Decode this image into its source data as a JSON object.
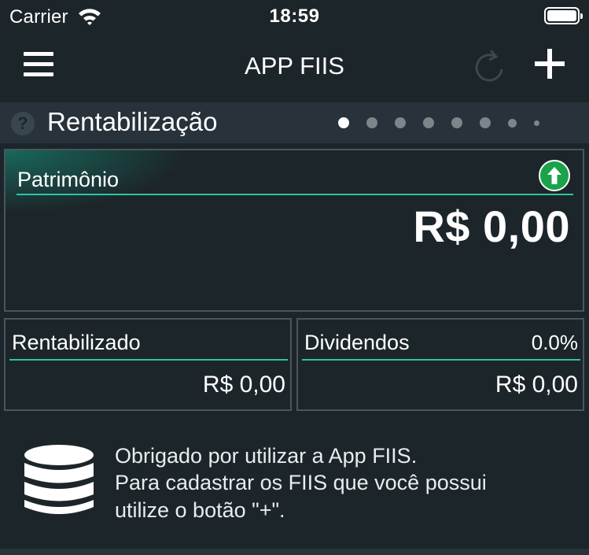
{
  "status_bar": {
    "carrier": "Carrier",
    "time": "18:59"
  },
  "nav": {
    "title": "APP FIIS",
    "icons": [
      "menu-icon",
      "refresh-icon",
      "add-icon"
    ]
  },
  "section": {
    "title": "Rentabilização",
    "help_icon_text": "?",
    "pages_total": 8,
    "active_page": 1
  },
  "cards": {
    "patrimonio": {
      "label": "Patrimônio",
      "value": "R$ 0,00",
      "trend_icon": "arrow-up-icon"
    },
    "rentabilizado": {
      "label": "Rentabilizado",
      "value": "R$ 0,00"
    },
    "dividendos": {
      "label": "Dividendos",
      "percent": "0.0%",
      "value": "R$ 0,00"
    }
  },
  "message": {
    "icon": "database-icon",
    "line1": "Obrigado por utilizar a App FIIS.",
    "line2": "Para cadastrar os FIIS que você possui",
    "line3": "utilize o botão \"+\"."
  },
  "colors": {
    "background": "#1c252a",
    "header_band": "#27323a",
    "accent": "#2fc4a4",
    "up_green": "#1aa34a",
    "card_border": "#4a555c"
  }
}
